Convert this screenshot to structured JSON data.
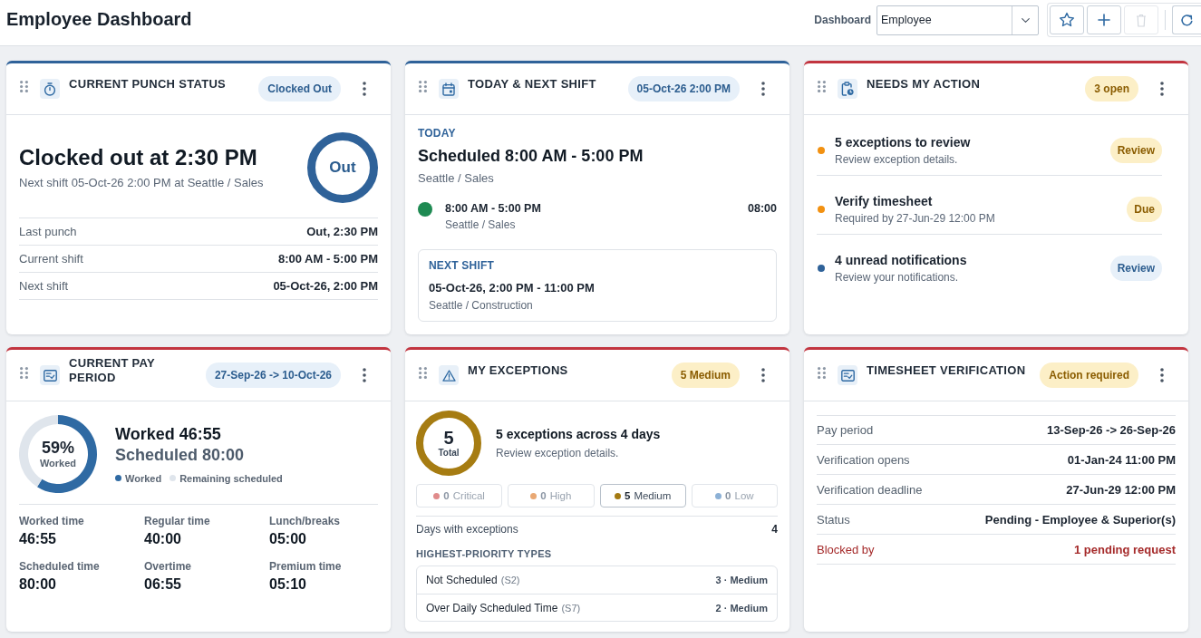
{
  "header": {
    "title": "Employee Dashboard",
    "dashboard_label": "Dashboard",
    "dashboard_select": {
      "value": "Employee"
    },
    "toolbar": [
      {
        "kind": "star",
        "disabled": false
      },
      {
        "kind": "add",
        "disabled": false
      },
      {
        "kind": "delete",
        "disabled": true
      },
      {
        "kind": "refresh",
        "disabled": false
      }
    ]
  },
  "cards": [
    {
      "kind": "punch",
      "title": "CURRENT PUNCH STATUS",
      "color": "#2f6299",
      "badge": {
        "text": "Clocked Out",
        "kind": "info"
      },
      "headline": "Clocked out at 2:30 PM",
      "subline": "Next shift 05-Oct-26 2:00 PM at Seattle / Sales",
      "ring_label": "Out",
      "rows": [
        {
          "label": "Last punch",
          "value": "Out, 2:30 PM"
        },
        {
          "label": "Current shift",
          "value": "8:00 AM - 5:00 PM"
        },
        {
          "label": "Next shift",
          "value": "05-Oct-26, 2:00 PM"
        }
      ]
    },
    {
      "kind": "shift",
      "title": "TODAY & NEXT SHIFT",
      "color": "#2f6299",
      "badge": {
        "text": "05-Oct-26 2:00 PM",
        "kind": "info"
      },
      "today": {
        "label": "TODAY",
        "headline": "Scheduled 8:00 AM - 5:00 PM",
        "location": "Seattle / Sales",
        "segments": [
          {
            "time": "8:00 AM - 5:00 PM",
            "location": "Seattle / Sales",
            "duration": "08:00",
            "color": "#1e8a52"
          }
        ]
      },
      "next_shift": {
        "label": "NEXT SHIFT",
        "time": "05-Oct-26, 2:00 PM - 11:00 PM",
        "location": "Seattle / Construction"
      }
    },
    {
      "kind": "actions",
      "title": "NEEDS MY ACTION",
      "color": "#c2343f",
      "badge": {
        "text": "3 open",
        "kind": "warning"
      },
      "items": [
        {
          "title": "5 exceptions to review",
          "detail": "Review exception details.",
          "color": "#f29111",
          "action": {
            "text": "Review",
            "kind": "warning"
          }
        },
        {
          "title": "Verify timesheet",
          "detail": "Required by 27-Jun-29 12:00 PM",
          "color": "#f29111",
          "action": {
            "text": "Due",
            "kind": "warning"
          }
        },
        {
          "title": "4 unread notifications",
          "detail": "Review your notifications.",
          "color": "#2f6299",
          "action": {
            "text": "Review",
            "kind": "info"
          }
        }
      ]
    },
    {
      "kind": "pay",
      "title": "CURRENT PAY PERIOD",
      "color": "#c2343f",
      "badge": {
        "text": "27-Sep-26 -> 10-Oct-26",
        "kind": "info"
      },
      "chart_data": {
        "type": "donut",
        "categories": [
          "Worked",
          "Remaining scheduled"
        ],
        "values": [
          59,
          41
        ]
      },
      "percent": "59%",
      "percent_label": "Worked",
      "worked": "Worked 46:55",
      "scheduled": "Scheduled 80:00",
      "stats": [
        {
          "label": "Worked time",
          "value": "46:55"
        },
        {
          "label": "Regular time",
          "value": "40:00"
        },
        {
          "label": "Lunch/breaks",
          "value": "05:00"
        },
        {
          "label": "Scheduled time",
          "value": "80:00"
        },
        {
          "label": "Overtime",
          "value": "06:55"
        },
        {
          "label": "Premium time",
          "value": "05:10"
        }
      ]
    },
    {
      "kind": "exceptions",
      "title": "MY EXCEPTIONS",
      "color": "#c2343f",
      "badge": {
        "text": "5 Medium",
        "kind": "warning"
      },
      "total": "5",
      "total_label": "Total",
      "headline": "5 exceptions across 4 days",
      "detail": "Review exception details.",
      "severities": [
        {
          "count": "0",
          "label": "Critical",
          "color": "#e08b8b",
          "selected": false
        },
        {
          "count": "0",
          "label": "High",
          "color": "#e9a873",
          "selected": false
        },
        {
          "count": "5",
          "label": "Medium",
          "color": "#a47a12",
          "selected": true
        },
        {
          "count": "0",
          "label": "Low",
          "color": "#8db1d6",
          "selected": false
        }
      ],
      "days_label": "Days with exceptions",
      "days_value": "4",
      "types_heading": "HIGHEST-PRIORITY TYPES",
      "types": [
        {
          "name": "Not Scheduled",
          "code": "(S2)",
          "summary": "3 · Medium"
        },
        {
          "name": "Over Daily Scheduled Time",
          "code": "(S7)",
          "summary": "2 · Medium"
        }
      ]
    },
    {
      "kind": "verification",
      "title": "TIMESHEET VERIFICATION",
      "color": "#c2343f",
      "badge": {
        "text": "Action required",
        "kind": "warning"
      },
      "rows": [
        {
          "label": "Pay period",
          "value": "13-Sep-26 -> 26-Sep-26",
          "kind": "plain"
        },
        {
          "label": "Verification opens",
          "value": "01-Jan-24 11:00 PM",
          "kind": "plain"
        },
        {
          "label": "Verification deadline",
          "value": "27-Jun-29 12:00 PM",
          "kind": "plain"
        },
        {
          "label": "Status",
          "value": "Pending - Employee & Superior(s)",
          "kind": "plain"
        },
        {
          "label": "Blocked by",
          "value": "1 pending request",
          "kind": "alert"
        }
      ]
    }
  ]
}
